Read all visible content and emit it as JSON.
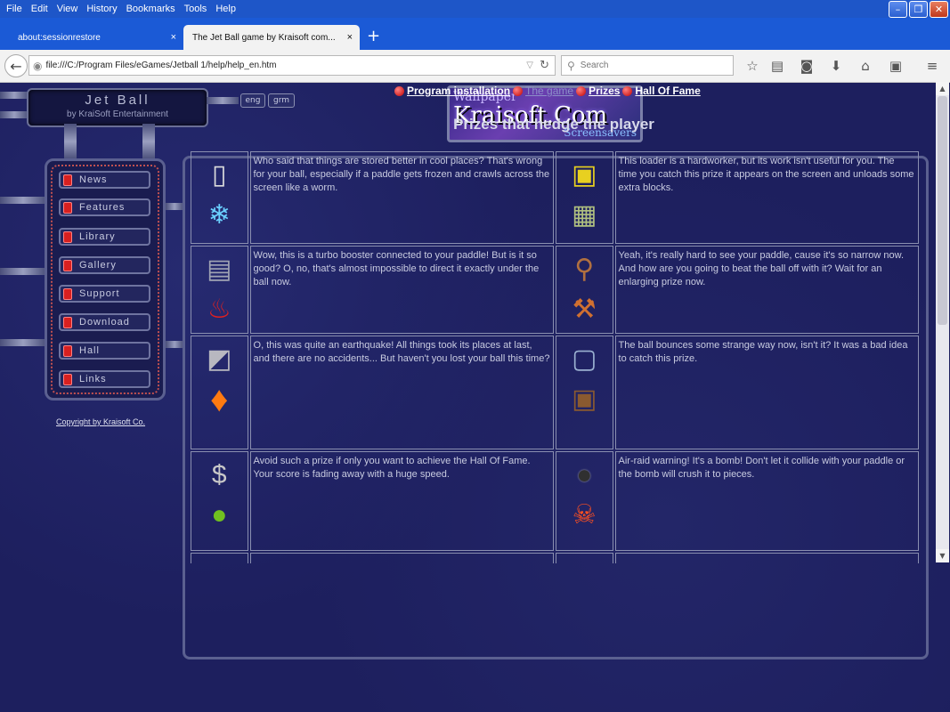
{
  "menu": [
    "File",
    "Edit",
    "View",
    "History",
    "Bookmarks",
    "Tools",
    "Help"
  ],
  "window_buttons": {
    "minimize": "–",
    "restore": "❐",
    "close": "✕"
  },
  "tabs": [
    {
      "label": "about:sessionrestore",
      "close": "×"
    },
    {
      "label": "The Jet Ball game by Kraisoft com...",
      "close": "×"
    }
  ],
  "new_tab": "+",
  "url": "file:///C:/Program Files/eGames/Jetball 1/help/help_en.htm",
  "search_placeholder": "Search",
  "toolbar_icons": [
    "star-icon",
    "reading-list-icon",
    "pocket-icon",
    "download-icon",
    "home-icon",
    "sync-icon",
    "menu-icon"
  ],
  "site": {
    "logo_title": "Jet Ball",
    "logo_sub": "by KraiSoft Entertainment",
    "lang": [
      "eng",
      "grm"
    ],
    "banner_top": "Wallpaper",
    "banner_main": "Kraisoft.Com",
    "banner_bottom": "Screensavers",
    "nav": [
      "News",
      "Features",
      "Library",
      "Gallery",
      "Support",
      "Download",
      "Hall",
      "Links"
    ],
    "copyright": "Copyright by Kraisoft Co."
  },
  "links": [
    {
      "label": "Program installation",
      "current": false
    },
    {
      "label": "The game",
      "current": true
    },
    {
      "label": "Prizes",
      "current": false
    },
    {
      "label": "Hall Of Fame",
      "current": false
    }
  ],
  "heading": "Prizes that hedge the player",
  "prizes": [
    {
      "icons": [
        "fridge-icon",
        "ice-icon"
      ],
      "text": "Who said that things are stored better in cool places? That's wrong for your ball, especially if a paddle gets frozen and crawls across the screen like a worm.",
      "icons2": [
        "loader-icon",
        "blocks-icon"
      ],
      "text2": "This loader is a hardworker, but its work isn't useful for you. The time you catch this prize it appears on the screen and unloads some extra blocks."
    },
    {
      "icons": [
        "turbo-icon",
        "chili-icon"
      ],
      "text": "Wow, this is a turbo booster connected to your paddle! But is it so good? O, no, that's almost impossible to direct it exactly under the ball now.",
      "icons2": [
        "magnifier-icon",
        "axe-icon"
      ],
      "text2": "Yeah, it's really hard to see your paddle, cause it's so narrow now. And how are you going to beat the ball off with it? Wait for an enlarging prize now."
    },
    {
      "icons": [
        "frame-icon",
        "fireball-icon"
      ],
      "text": "O, this was quite an earthquake! All things took its places at last, and there are no accidents... But haven't you lost your ball this time?",
      "icons2": [
        "box-ball-icon",
        "frame-ball-icon"
      ],
      "text2": "The ball bounces some strange way now, isn't it? It was a bad idea to catch this prize."
    },
    {
      "icons": [
        "dollar-coin-icon",
        "apple-icon"
      ],
      "text": "Avoid such a prize if only you want to achieve the Hall Of Fame. Your score is fading away with a huge speed.",
      "icons2": [
        "bomb-icon",
        "skull-explosion-icon"
      ],
      "text2": "Air-raid warning! It's a bomb! Don't let it collide with your paddle or the bomb will crush it to pieces."
    }
  ]
}
